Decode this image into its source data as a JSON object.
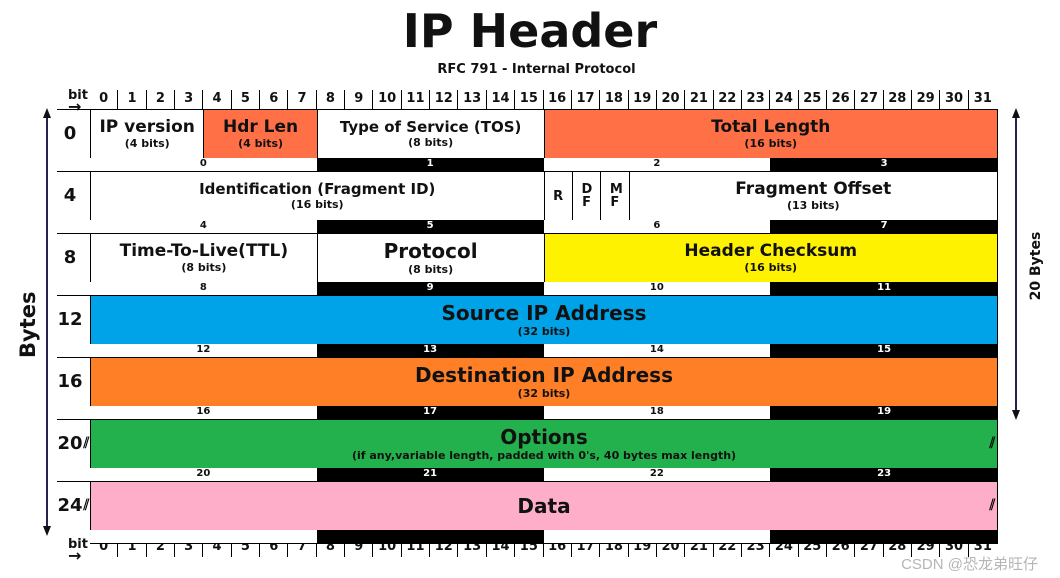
{
  "title": "IP Header",
  "subtitle": "RFC 791 - Internal Protocol",
  "bit_axis": {
    "label": "bit",
    "arrow": "→",
    "ticks": [
      "0",
      "1",
      "2",
      "3",
      "4",
      "5",
      "6",
      "7",
      "8",
      "9",
      "10",
      "11",
      "12",
      "13",
      "14",
      "15",
      "16",
      "17",
      "18",
      "19",
      "20",
      "21",
      "22",
      "23",
      "24",
      "25",
      "26",
      "27",
      "28",
      "29",
      "30",
      "31"
    ]
  },
  "left_axis_label": "Bytes",
  "right_axis_label": "20 Bytes",
  "rows": [
    {
      "offset": "0",
      "fields": [
        {
          "name": "IP version",
          "bits": "(4 bits)",
          "start": 0,
          "end": 4,
          "color": "#ffffff"
        },
        {
          "name": "Hdr Len",
          "bits": "(4 bits)",
          "start": 4,
          "end": 8,
          "color": "#ff7046"
        },
        {
          "name": "Type of Service (TOS)",
          "bits": "(8 bits)",
          "start": 8,
          "end": 16,
          "color": "#ffffff"
        },
        {
          "name": "Total Length",
          "bits": "(16 bits)",
          "start": 16,
          "end": 32,
          "color": "#ff7046"
        }
      ],
      "byte_indices": [
        "0",
        "1",
        "2",
        "3"
      ]
    },
    {
      "offset": "4",
      "fields": [
        {
          "name": "Identification (Fragment ID)",
          "bits": "(16 bits)",
          "start": 0,
          "end": 16,
          "color": "#ffffff"
        },
        {
          "name": "R",
          "bits": "",
          "start": 16,
          "end": 17,
          "color": "#ffffff",
          "flag": true
        },
        {
          "name": "DF",
          "bits": "",
          "start": 17,
          "end": 18,
          "color": "#ffffff",
          "flag": true
        },
        {
          "name": "MF",
          "bits": "",
          "start": 18,
          "end": 19,
          "color": "#ffffff",
          "flag": true
        },
        {
          "name": "Fragment Offset",
          "bits": "(13 bits)",
          "start": 19,
          "end": 32,
          "color": "#ffffff"
        }
      ],
      "byte_indices": [
        "4",
        "5",
        "6",
        "7"
      ]
    },
    {
      "offset": "8",
      "fields": [
        {
          "name": "Time-To-Live(TTL)",
          "bits": "(8 bits)",
          "start": 0,
          "end": 8,
          "color": "#ffffff"
        },
        {
          "name": "Protocol",
          "bits": "(8 bits)",
          "start": 8,
          "end": 16,
          "color": "#ffffff",
          "big": true
        },
        {
          "name": "Header Checksum",
          "bits": "(16 bits)",
          "start": 16,
          "end": 32,
          "color": "#fff200"
        }
      ],
      "byte_indices": [
        "8",
        "9",
        "10",
        "11"
      ]
    },
    {
      "offset": "12",
      "fields": [
        {
          "name": "Source IP Address",
          "bits": "(32 bits)",
          "start": 0,
          "end": 32,
          "color": "#00a2e8",
          "big": true
        }
      ],
      "byte_indices": [
        "12",
        "13",
        "14",
        "15"
      ]
    },
    {
      "offset": "16",
      "fields": [
        {
          "name": "Destination IP Address",
          "bits": "(32 bits)",
          "start": 0,
          "end": 32,
          "color": "#ff7f27",
          "big": true
        }
      ],
      "byte_indices": [
        "16",
        "17",
        "18",
        "19"
      ]
    },
    {
      "offset": "20",
      "fields": [
        {
          "name": "Options",
          "bits": "(if any,variable length, padded with 0's, 40 bytes max length)",
          "start": 0,
          "end": 32,
          "color": "#22b14c",
          "big": true
        }
      ],
      "byte_indices": [
        "20",
        "21",
        "22",
        "23"
      ],
      "variable": true
    },
    {
      "offset": "24",
      "fields": [
        {
          "name": "Data",
          "bits": "",
          "start": 0,
          "end": 32,
          "color": "#ffaec9",
          "big": true
        }
      ],
      "byte_indices": [
        "",
        "",
        "",
        ""
      ],
      "variable": true
    }
  ],
  "hatch_glyph": "//",
  "watermark": "CSDN @恐龙弟旺仔"
}
